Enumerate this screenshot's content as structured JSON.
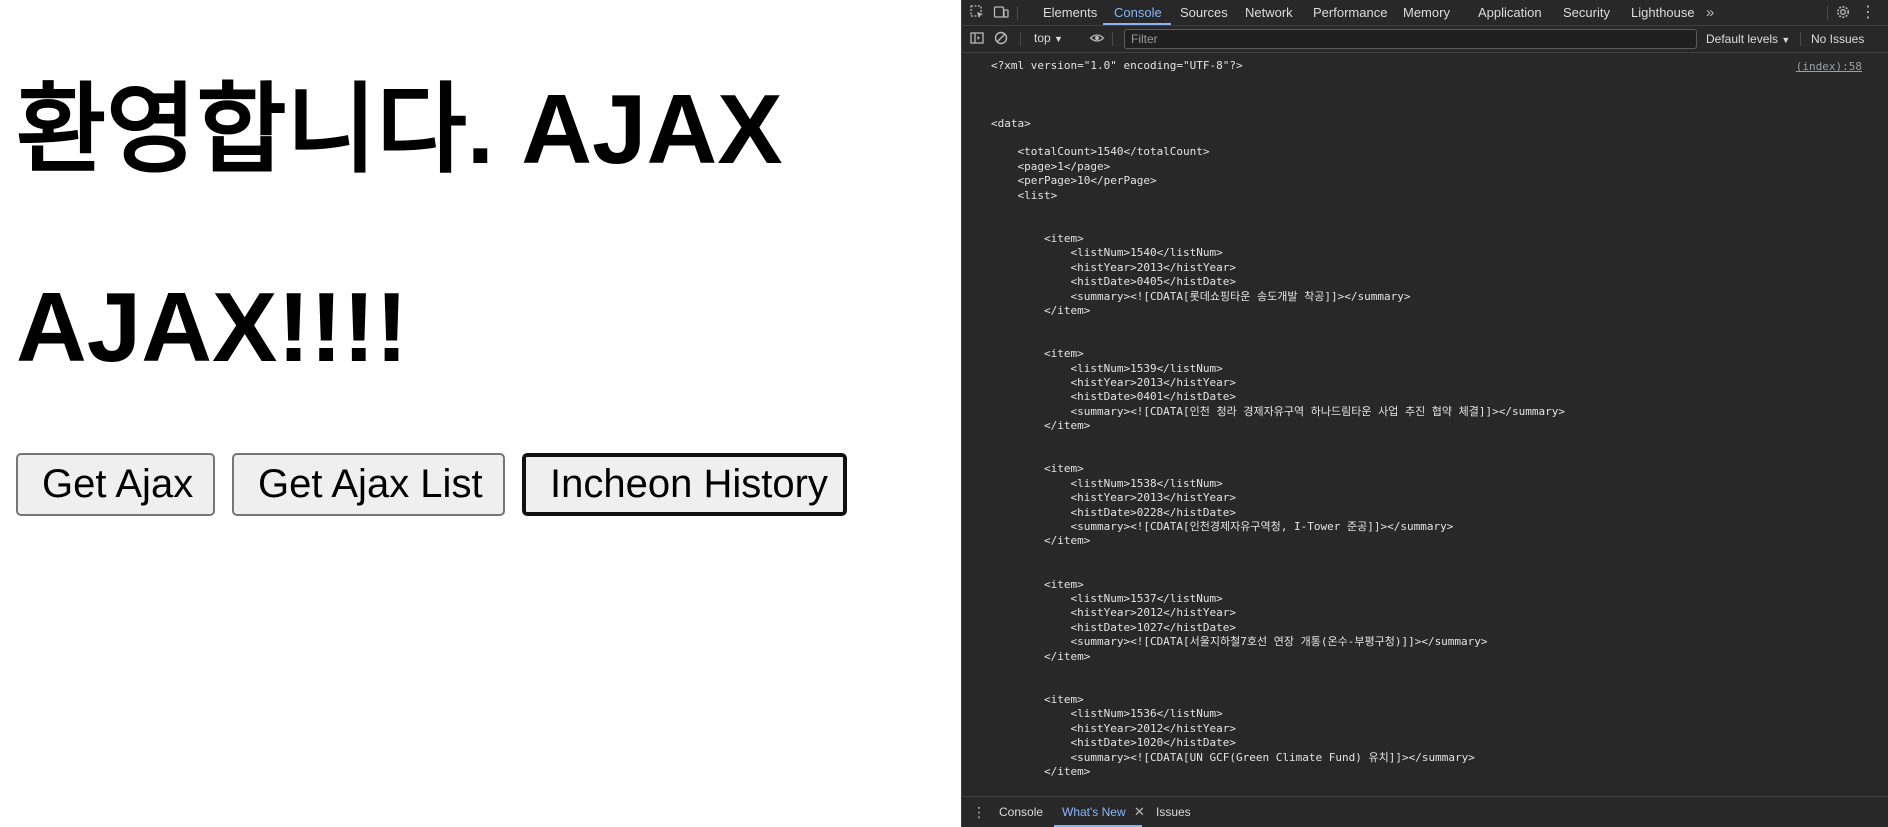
{
  "page": {
    "heading_welcome": "환영합니다. AJAX",
    "heading_ajax": "AJAX!!!!",
    "buttons": {
      "get_ajax": "Get Ajax",
      "get_ajax_list": "Get Ajax List",
      "incheon_history": "Incheon History"
    }
  },
  "devtools": {
    "tabs": [
      "Elements",
      "Console",
      "Sources",
      "Network",
      "Performance",
      "Memory",
      "Application",
      "Security",
      "Lighthouse"
    ],
    "active_tab": "Console",
    "more_tabs_icon": "chevron-double-right-icon",
    "toolbar": {
      "context": "top",
      "filter_placeholder": "Filter",
      "levels": "Default levels",
      "issues": "No Issues"
    },
    "console": {
      "source_link": "(index):58",
      "xml_lines": [
        "<?xml version=\"1.0\" encoding=\"UTF-8\"?>",
        "",
        "",
        "",
        "<data>",
        "",
        "    <totalCount>1540</totalCount>",
        "    <page>1</page>",
        "    <perPage>10</perPage>",
        "    <list>",
        "",
        "",
        "        <item>",
        "            <listNum>1540</listNum>",
        "            <histYear>2013</histYear>",
        "            <histDate>0405</histDate>",
        "            <summary><![CDATA[롯데쇼핑타운 송도개발 착공]]></summary>",
        "        </item>",
        "",
        "",
        "        <item>",
        "            <listNum>1539</listNum>",
        "            <histYear>2013</histYear>",
        "            <histDate>0401</histDate>",
        "            <summary><![CDATA[인천 청라 경제자유구역 하나드림타운 사업 추진 협약 체결]]></summary>",
        "        </item>",
        "",
        "",
        "        <item>",
        "            <listNum>1538</listNum>",
        "            <histYear>2013</histYear>",
        "            <histDate>0228</histDate>",
        "            <summary><![CDATA[인천경제자유구역청, I-Tower 준공]]></summary>",
        "        </item>",
        "",
        "",
        "        <item>",
        "            <listNum>1537</listNum>",
        "            <histYear>2012</histYear>",
        "            <histDate>1027</histDate>",
        "            <summary><![CDATA[서울지하철7호선 연장 개통(온수-부평구청)]]></summary>",
        "        </item>",
        "",
        "",
        "        <item>",
        "            <listNum>1536</listNum>",
        "            <histYear>2012</histYear>",
        "            <histDate>1020</histDate>",
        "            <summary><![CDATA[UN GCF(Green Climate Fund) 유치]]></summary>",
        "        </item>"
      ]
    },
    "drawer": {
      "tabs": [
        "Console",
        "What's New",
        "Issues"
      ],
      "active_tab": "What's New"
    }
  },
  "colors": {
    "devtools_bg": "#282828",
    "accent": "#8ab4f8",
    "button_bg": "#efefef"
  }
}
